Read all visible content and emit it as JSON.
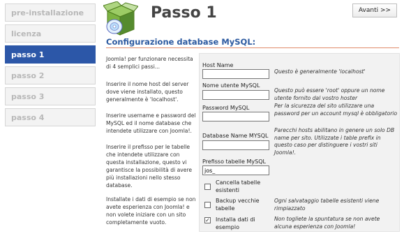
{
  "sidebar": {
    "steps": [
      {
        "label": "pre-installazione"
      },
      {
        "label": "licenza"
      },
      {
        "label": "passo 1"
      },
      {
        "label": "passo 2"
      },
      {
        "label": "passo 3"
      },
      {
        "label": "passo 4"
      }
    ],
    "active_index": 2
  },
  "header": {
    "title": "Passo 1",
    "next_label": "Avanti >>"
  },
  "section": {
    "title": "Configurazione database MySQL:"
  },
  "descriptions": [
    "Joomla! per funzionare necessita di 4 semplici passi...",
    "Inserire il nome host del server dove viene installato, questo generalmente è 'localhost'.",
    "Inserire username e password del MySQL ed il nome database che intendete utilizzare con Joomla!.",
    "Inserire il prefisso per le tabelle che intendete utilizzare con questa installazione, questo vi garantisce la possibilità di avere più installazioni nello stesso database.",
    "Installate i dati di esempio se non avete esperienza con Joomla! e non volete iniziare con un sito completamente vuoto."
  ],
  "form": {
    "host": {
      "label": "Host Name",
      "value": "",
      "hint": "Questo è generalmente 'localhost'"
    },
    "user": {
      "label": "Nome utente MySQL",
      "value": "",
      "hint": "Questo può essere 'root' oppure un nome utente fornito dal vostro hoster"
    },
    "password": {
      "label": "Password MySQL",
      "value": "",
      "hint": "Per la sicurezza del sito utilizzare una password per un account mysql è obbligatorio"
    },
    "dbname": {
      "label": "Database Name MYSQL",
      "value": "",
      "hint": "Parecchi hosts abilitano in genere un solo DB name per sito. Utilizzate i table prefix in questo caso per distinguere i vostri siti Joomla!."
    },
    "prefix": {
      "label": "Prefisso tabelle MySQL",
      "value": "jos_"
    },
    "delete_tables": {
      "label": "Cancella tabelle esistenti",
      "checked": false
    },
    "backup_tables": {
      "label": "Backup vecchie tabelle",
      "checked": false,
      "hint": "Ogni salvataggio tabelle esistenti viene rimpiazzato"
    },
    "sample_data": {
      "label": "Installa dati di esempio",
      "checked": true,
      "hint": "Non togliete la spuntatura se non avete alcuna esperienza con Joomla!"
    }
  },
  "colors": {
    "accent": "#2c57a8",
    "rule": "#e08a6a",
    "logo_box": "#7cb342"
  },
  "icons": {
    "logo": "joomla-box-cd-icon"
  }
}
